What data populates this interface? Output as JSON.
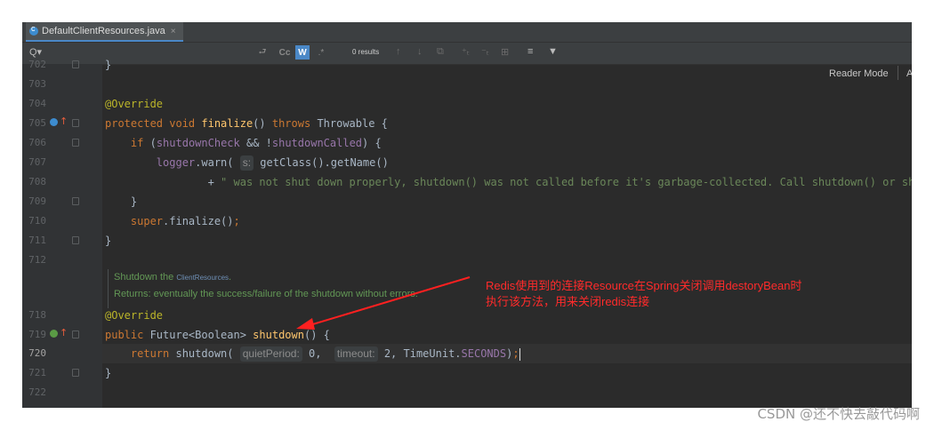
{
  "tab": {
    "filename": "DefaultClientResources.java",
    "close": "×"
  },
  "search": {
    "search_icon": "Q▾",
    "new_line_icon": "⮐",
    "match_case_label": "Cc",
    "words_label": "W",
    "regex_label": ".*",
    "results": "0 results",
    "nav_icons": [
      "↑",
      "↓",
      "⧉",
      "⁺ₜ",
      "⁻ₜ",
      "⊞",
      "≡",
      "▼"
    ]
  },
  "reader_mode": "Reader Mode",
  "reader_mode_extra": "A",
  "lines": [
    {
      "num": "702",
      "text": "}"
    },
    {
      "num": "703",
      "text": ""
    },
    {
      "num": "704",
      "text": "@Override"
    },
    {
      "num": "705",
      "text": "protected void finalize() throws Throwable {"
    },
    {
      "num": "706",
      "text": "if (shutdownCheck && !shutdownCalled) {"
    },
    {
      "num": "707",
      "text": "logger.warn( s: getClass().getName()"
    },
    {
      "num": "708",
      "text": "+ \" was not shut down properly, shutdown() was not called before it's garbage-collected. Call shutdown() or shutdown(long,"
    },
    {
      "num": "709",
      "text": "}"
    },
    {
      "num": "710",
      "text": "super.finalize();"
    },
    {
      "num": "711",
      "text": "}"
    },
    {
      "num": "712",
      "text": ""
    },
    {
      "num": "718",
      "text": "@Override"
    },
    {
      "num": "719",
      "text": "public Future<Boolean> shutdown() {"
    },
    {
      "num": "720",
      "text": "return shutdown( quietPeriod: 0,  timeout: 2, TimeUnit.SECONDS);"
    },
    {
      "num": "721",
      "text": "}"
    },
    {
      "num": "722",
      "text": ""
    }
  ],
  "doc": {
    "line1_prefix": "Shutdown the ",
    "line1_code": "ClientResources",
    "line1_suffix": ".",
    "line2": "Returns: eventually the success/failure of the shutdown without errors."
  },
  "annotation": {
    "line1": "Redis使用到的连接Resource在Spring关闭调用destoryBean时",
    "line2": "执行该方法，用来关闭redis连接",
    "color": "#ff2b2b"
  },
  "watermark": "CSDN @还不快去敲代码啊",
  "colors": {
    "editor_bg": "#2b2b2b",
    "keyword": "#cc7832",
    "annotation": "#bbb529",
    "method": "#ffc66d",
    "field": "#9876aa",
    "string": "#6a8759",
    "doc": "#629755"
  }
}
